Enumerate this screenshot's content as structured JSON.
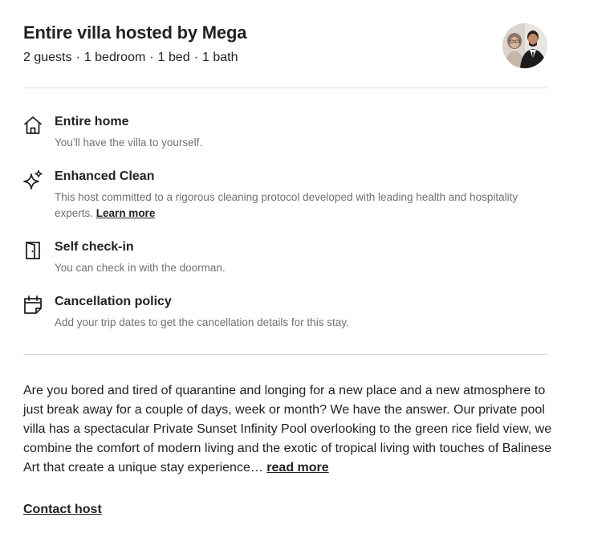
{
  "header": {
    "title": "Entire villa hosted by Mega",
    "guests": "2 guests",
    "bedrooms": "1 bedroom",
    "beds": "1 bed",
    "baths": "1 bath",
    "separator": "·"
  },
  "features": [
    {
      "icon": "home-icon",
      "title": "Entire home",
      "description": "You’ll have the villa to yourself."
    },
    {
      "icon": "sparkle-icon",
      "title": "Enhanced Clean",
      "description": "This host committed to a rigorous cleaning protocol developed with leading health and hospitality experts.",
      "link": "Learn more"
    },
    {
      "icon": "door-icon",
      "title": "Self check-in",
      "description": "You can check in with the doorman."
    },
    {
      "icon": "calendar-icon",
      "title": "Cancellation policy",
      "description": "Add your trip dates to get the cancellation details for this stay."
    }
  ],
  "description": {
    "text": "Are you bored and tired of quarantine and longing for a new place and a new atmosphere to just break away for a couple of days, week or month? We have the answer. Our private pool villa has a spectacular Private Sunset Infinity Pool overlooking to the green rice field view, we combine the comfort of modern living and the exotic of tropical living with touches of Balinese Art that create a unique stay experience…",
    "read_more": "read more"
  },
  "contact_host": "Contact host"
}
